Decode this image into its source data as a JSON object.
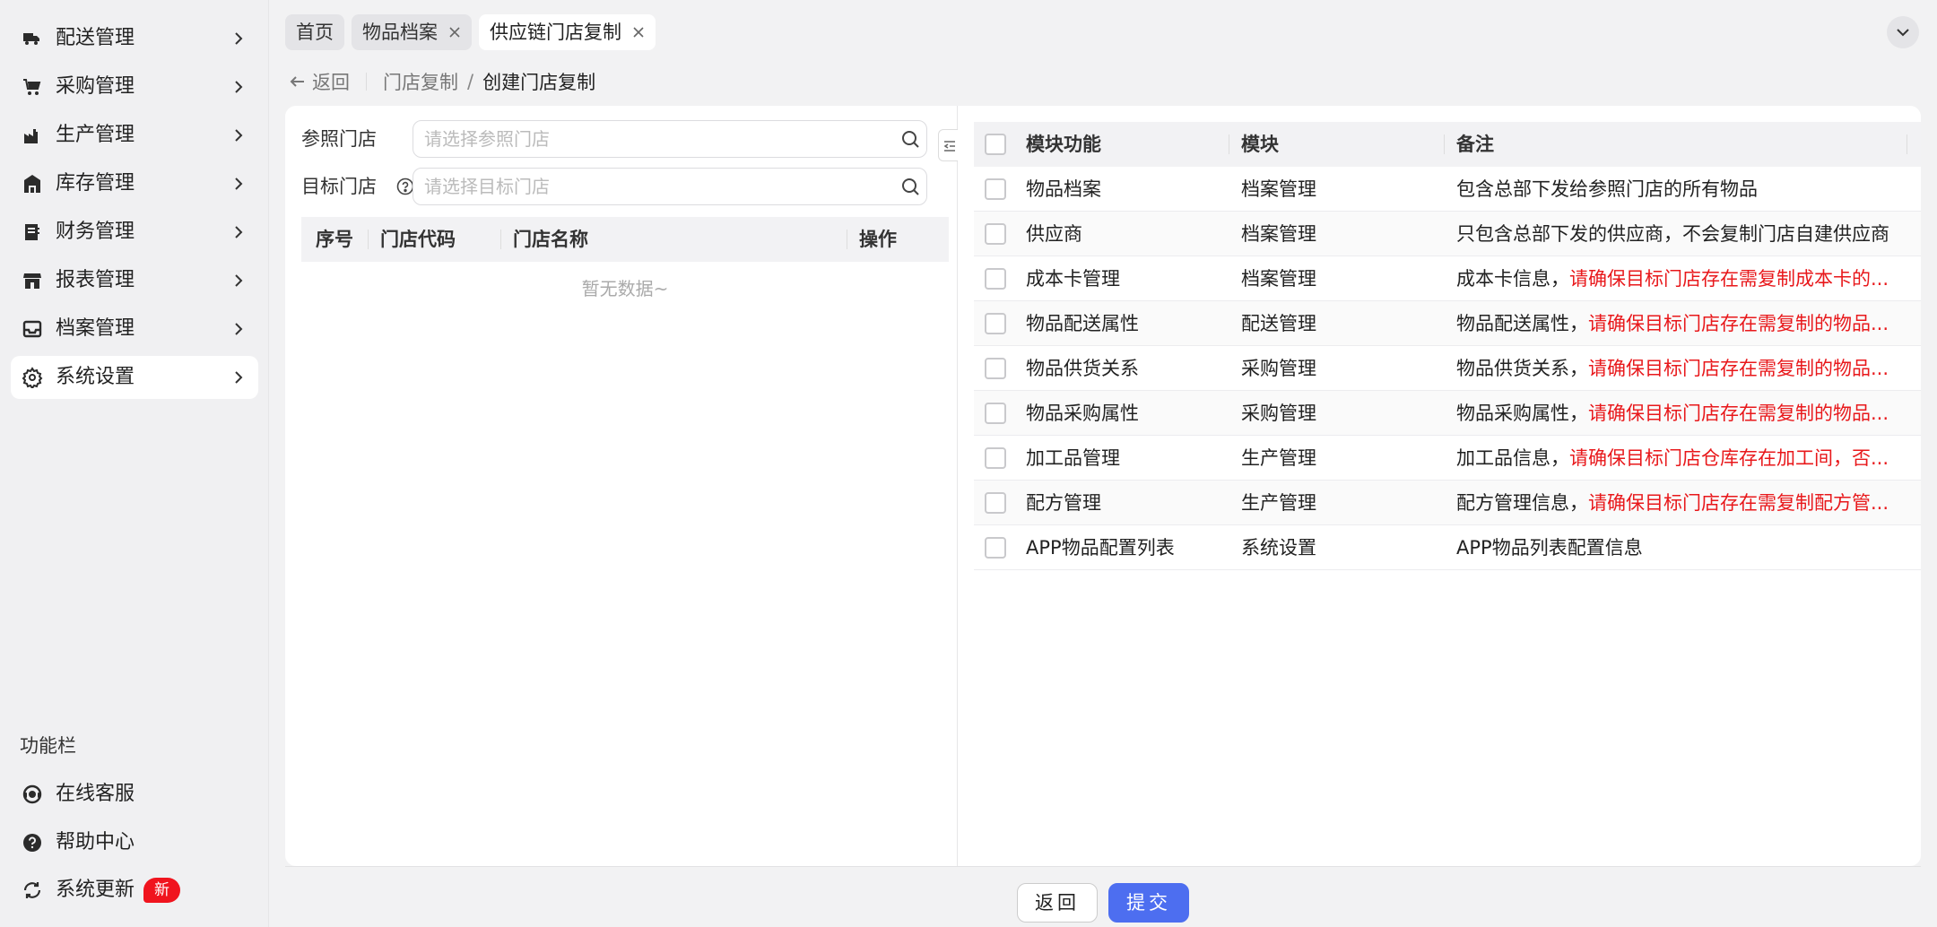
{
  "sidebar": {
    "items": [
      {
        "label": "配送管理",
        "icon": "truck-icon"
      },
      {
        "label": "采购管理",
        "icon": "cart-icon"
      },
      {
        "label": "生产管理",
        "icon": "factory-icon"
      },
      {
        "label": "库存管理",
        "icon": "warehouse-icon"
      },
      {
        "label": "财务管理",
        "icon": "ledger-icon"
      },
      {
        "label": "报表管理",
        "icon": "store-icon"
      },
      {
        "label": "档案管理",
        "icon": "inbox-icon"
      },
      {
        "label": "系统设置",
        "icon": "gear-icon",
        "active": true
      }
    ],
    "function_bar_title": "功能栏",
    "utilities": [
      {
        "label": "在线客服",
        "icon": "headset-icon"
      },
      {
        "label": "帮助中心",
        "icon": "help-circle-icon"
      },
      {
        "label": "系统更新",
        "icon": "refresh-icon",
        "badge": "新"
      }
    ]
  },
  "tabs": [
    {
      "label": "首页",
      "closable": false
    },
    {
      "label": "物品档案",
      "closable": true
    },
    {
      "label": "供应链门店复制",
      "closable": true,
      "active": true
    }
  ],
  "breadcrumb": {
    "back_label": "返回",
    "items": [
      "门店复制",
      "创建门店复制"
    ]
  },
  "form": {
    "reference_label": "参照门店",
    "reference_placeholder": "请选择参照门店",
    "target_label": "目标门店",
    "target_placeholder": "请选择目标门店"
  },
  "store_table": {
    "headers": [
      "序号",
      "门店代码",
      "门店名称",
      "操作"
    ],
    "empty_text": "暂无数据~"
  },
  "module_table": {
    "headers": [
      "模块功能",
      "模块",
      "备注"
    ],
    "rows": [
      {
        "name": "物品档案",
        "module": "档案管理",
        "note": "包含总部下发给参照门店的所有物品",
        "note_warn": ""
      },
      {
        "name": "供应商",
        "module": "档案管理",
        "note": "只包含总部下发的供应商，不会复制门店自建供应商",
        "note_warn": ""
      },
      {
        "name": "成本卡管理",
        "module": "档案管理",
        "note": "成本卡信息，",
        "note_warn": "请确保目标门店存在需复制成本卡的..."
      },
      {
        "name": "物品配送属性",
        "module": "配送管理",
        "note": "物品配送属性，",
        "note_warn": "请确保目标门店存在需复制的物品..."
      },
      {
        "name": "物品供货关系",
        "module": "采购管理",
        "note": "物品供货关系，",
        "note_warn": "请确保目标门店存在需复制的物品..."
      },
      {
        "name": "物品采购属性",
        "module": "采购管理",
        "note": "物品采购属性，",
        "note_warn": "请确保目标门店存在需复制的物品..."
      },
      {
        "name": "加工品管理",
        "module": "生产管理",
        "note": "加工品信息，",
        "note_warn": "请确保目标门店仓库存在加工间，否..."
      },
      {
        "name": "配方管理",
        "module": "生产管理",
        "note": "配方管理信息，",
        "note_warn": "请确保目标门店存在需复制配方管..."
      },
      {
        "name": "APP物品配置列表",
        "module": "系统设置",
        "note": "APP物品列表配置信息",
        "note_warn": ""
      }
    ]
  },
  "footer": {
    "back_label": "返回",
    "submit_label": "提交"
  },
  "colors": {
    "primary": "#4d6ef0",
    "warning_text": "#e8181b",
    "badge": "#f0141e"
  }
}
